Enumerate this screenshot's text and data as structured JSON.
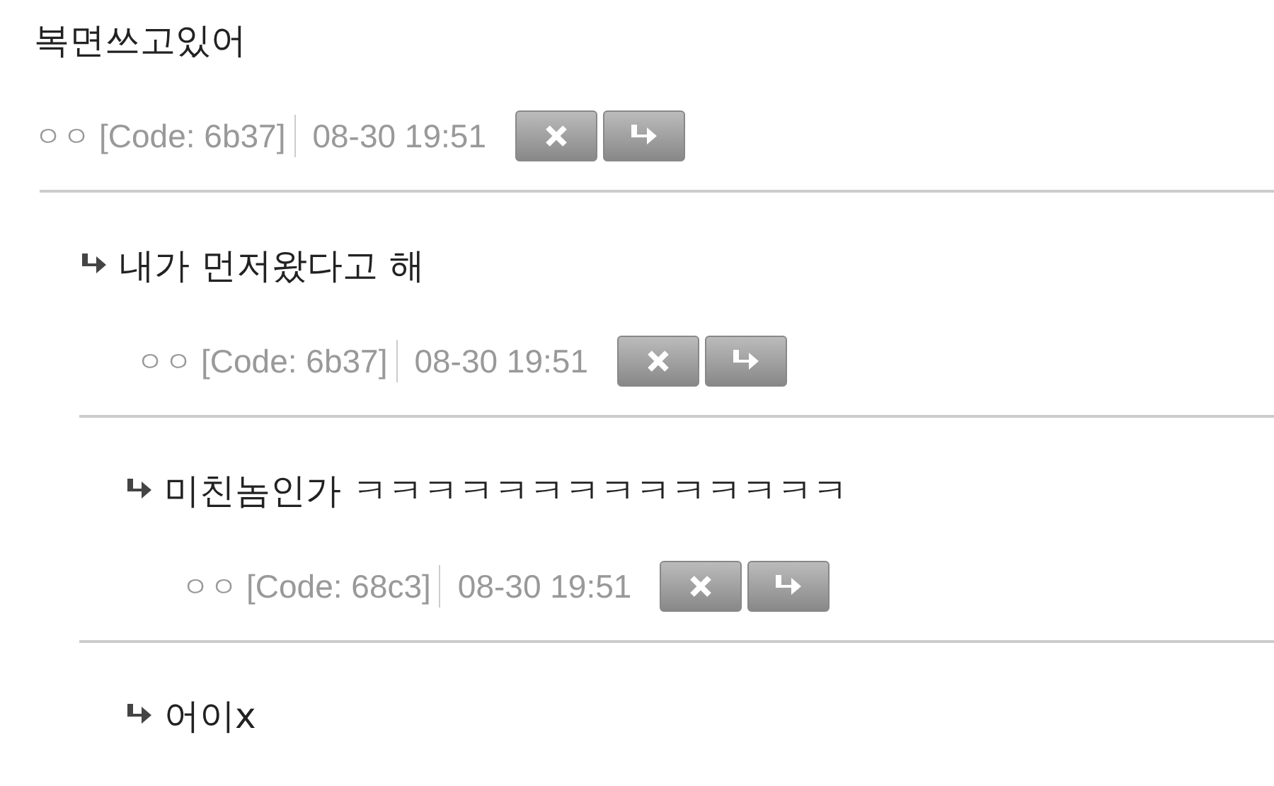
{
  "comments": [
    {
      "text": "복면쓰고있어",
      "author": "ㅇㅇ",
      "code": "[Code: 6b37]",
      "time": "08-30 19:51",
      "children": [
        {
          "text": "내가 먼저왔다고 해",
          "author": "ㅇㅇ",
          "code": "[Code: 6b37]",
          "time": "08-30 19:51",
          "children": [
            {
              "text": "미친놈인가 ㅋㅋㅋㅋㅋㅋㅋㅋㅋㅋㅋㅋㅋㅋ",
              "author": "ㅇㅇ",
              "code": "[Code: 68c3]",
              "time": "08-30 19:51"
            },
            {
              "text": "어이x"
            }
          ]
        }
      ]
    }
  ]
}
